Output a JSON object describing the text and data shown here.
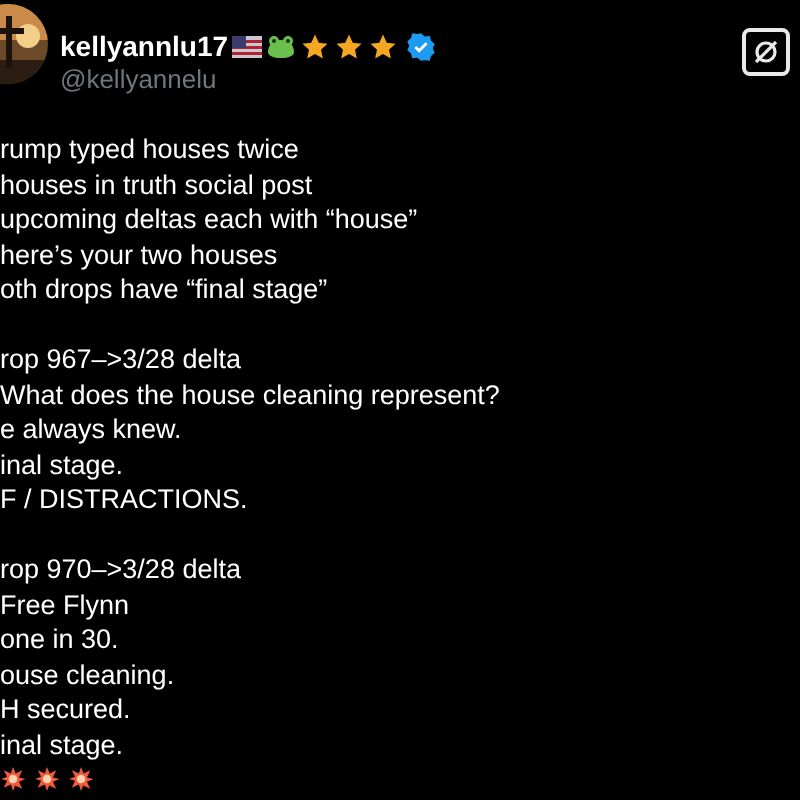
{
  "post": {
    "display_name": "kellyannlu17",
    "handle": "@kellyannelu",
    "paragraphs": [
      {
        "lines": [
          "rump typed houses twice",
          "houses in truth social post",
          "upcoming deltas each with “house”",
          "here’s your two houses",
          "oth drops have “final stage”"
        ]
      },
      {
        "lines": [
          "rop 967–>3/28 delta",
          "What does the house cleaning represent?",
          "e always knew.",
          "inal stage.",
          "F / DISTRACTIONS."
        ]
      },
      {
        "lines": [
          "rop 970–>3/28 delta",
          "Free Flynn",
          "one in 30.",
          "ouse cleaning.",
          "H secured.",
          "inal stage."
        ]
      }
    ]
  }
}
